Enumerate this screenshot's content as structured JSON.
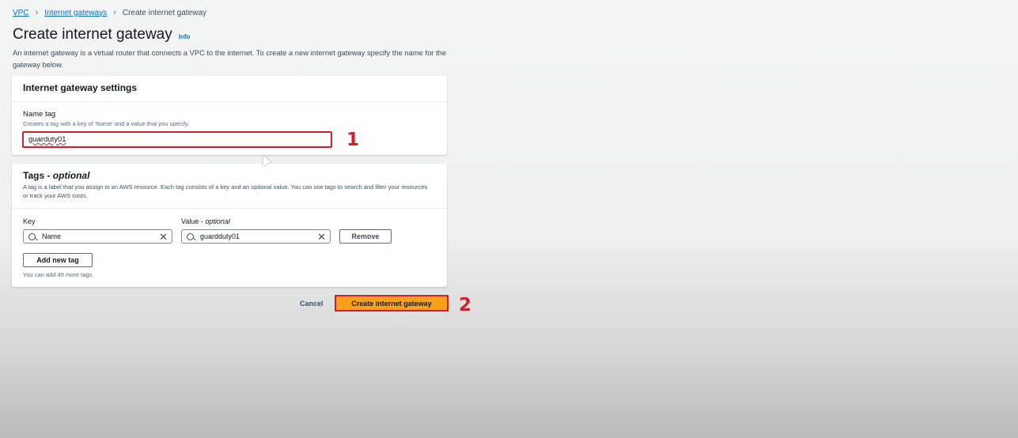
{
  "breadcrumb": {
    "items": [
      "VPC",
      "Internet gateways",
      "Create internet gateway"
    ]
  },
  "page": {
    "title": "Create internet gateway",
    "info": "Info",
    "description": "An internet gateway is a virtual router that connects a VPC to the internet. To create a new internet gateway specify the name for the gateway below."
  },
  "settings": {
    "header": "Internet gateway settings",
    "name_label": "Name tag",
    "name_hint": "Creates a tag with a key of 'Name' and a value that you specify.",
    "name_value": "guarduty01"
  },
  "tags": {
    "header": "Tags - ",
    "header_optional": "optional",
    "description": "A tag is a label that you assign to an AWS resource. Each tag consists of a key and an optional value. You can use tags to search and filter your resources or track your AWS costs.",
    "key_label": "Key",
    "value_label": "Value - ",
    "value_label_optional": "optional",
    "key_value": "Name",
    "value_value": "guardduty01",
    "remove_label": "Remove",
    "add_label": "Add new tag",
    "remaining": "You can add 49 more tags."
  },
  "actions": {
    "cancel": "Cancel",
    "create": "Create internet gateway"
  },
  "annotations": {
    "marker1": "1",
    "marker2": "2"
  },
  "colors": {
    "accent": "#0972d3",
    "primary_button": "#f7a01a",
    "highlight": "#d1202c"
  },
  "icons": [
    "chevron-right-icon",
    "search-icon",
    "clear-icon",
    "cursor-icon"
  ]
}
